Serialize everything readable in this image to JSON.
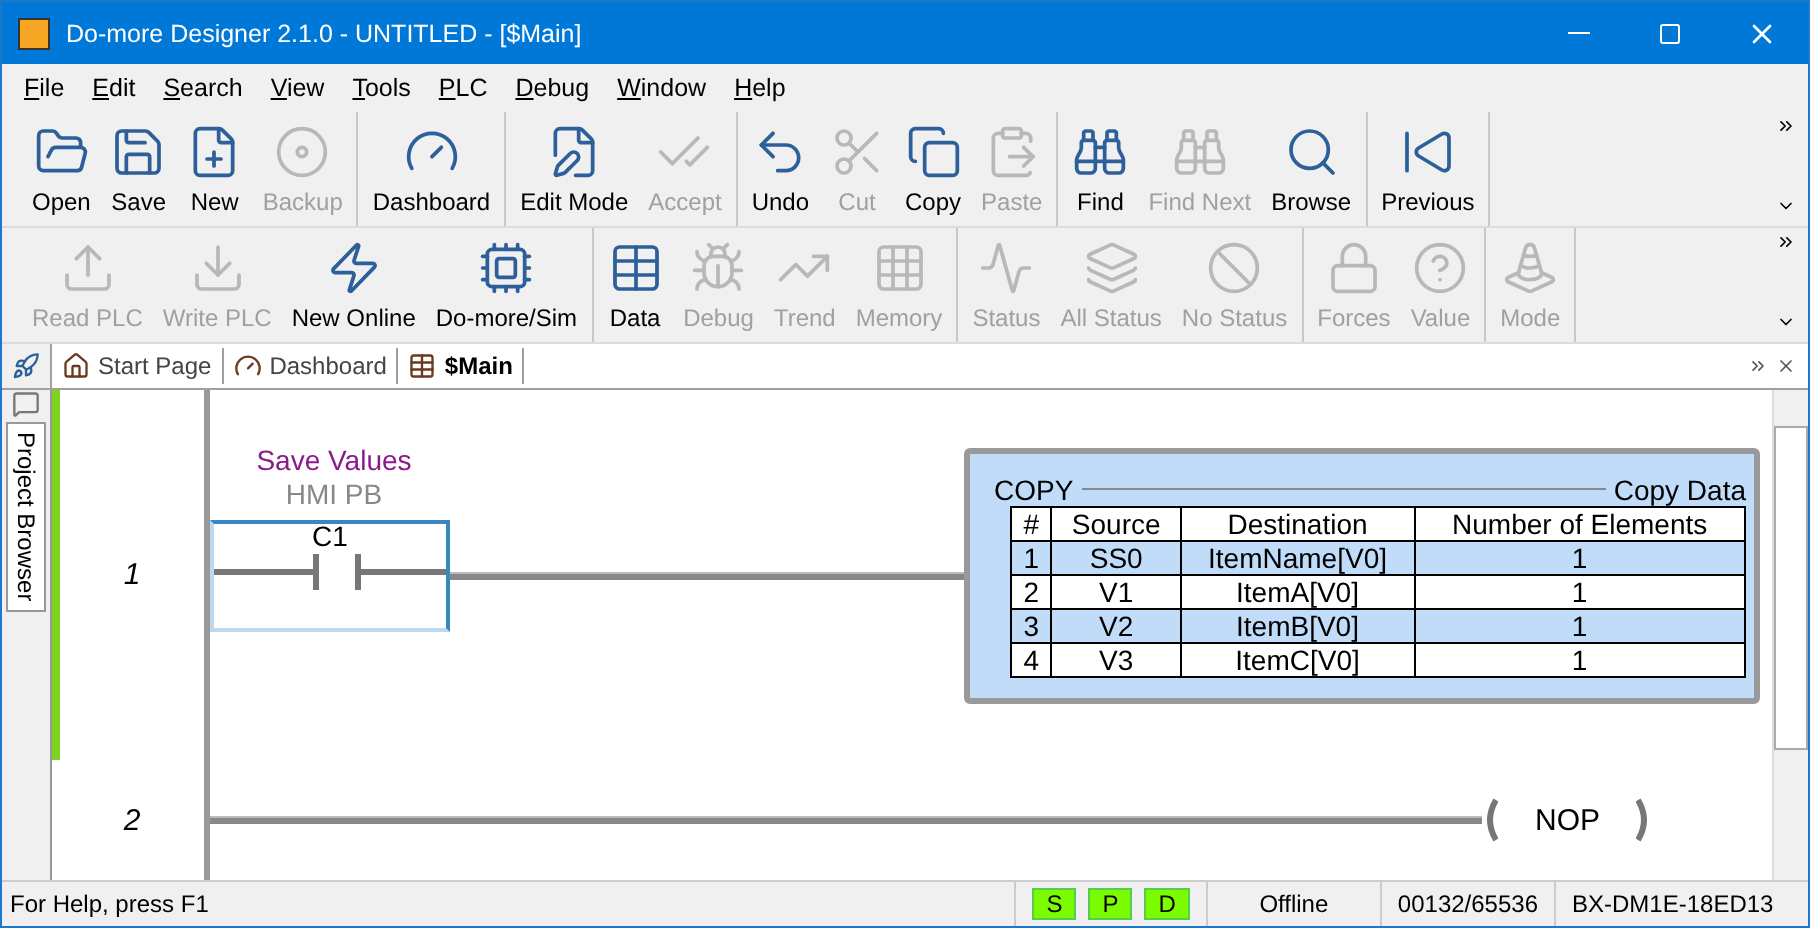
{
  "window": {
    "title": "Do-more Designer 2.1.0 - UNTITLED - [$Main]"
  },
  "menu": [
    "File",
    "Edit",
    "Search",
    "View",
    "Tools",
    "PLC",
    "Debug",
    "Window",
    "Help"
  ],
  "toolbars": [
    {
      "groups": [
        [
          {
            "label": "Open",
            "disabled": false
          },
          {
            "label": "Save",
            "disabled": false
          },
          {
            "label": "New",
            "disabled": false
          },
          {
            "label": "Backup",
            "disabled": true
          }
        ],
        [
          {
            "label": "Dashboard",
            "disabled": false
          }
        ],
        [
          {
            "label": "Edit Mode",
            "disabled": false
          },
          {
            "label": "Accept",
            "disabled": true
          }
        ],
        [
          {
            "label": "Undo",
            "disabled": false
          },
          {
            "label": "Cut",
            "disabled": true
          },
          {
            "label": "Copy",
            "disabled": false
          },
          {
            "label": "Paste",
            "disabled": true
          }
        ],
        [
          {
            "label": "Find",
            "disabled": false
          },
          {
            "label": "Find Next",
            "disabled": true
          },
          {
            "label": "Browse",
            "disabled": false
          }
        ],
        [
          {
            "label": "Previous",
            "disabled": false
          }
        ]
      ]
    },
    {
      "groups": [
        [
          {
            "label": "Read PLC",
            "disabled": true
          },
          {
            "label": "Write PLC",
            "disabled": true
          },
          {
            "label": "New Online",
            "disabled": false
          },
          {
            "label": "Do-more/Sim",
            "disabled": false
          }
        ],
        [
          {
            "label": "Data",
            "disabled": false
          },
          {
            "label": "Debug",
            "disabled": true
          },
          {
            "label": "Trend",
            "disabled": true
          },
          {
            "label": "Memory",
            "disabled": true
          }
        ],
        [
          {
            "label": "Status",
            "disabled": true
          },
          {
            "label": "All Status",
            "disabled": true
          },
          {
            "label": "No Status",
            "disabled": true
          }
        ],
        [
          {
            "label": "Forces",
            "disabled": true
          },
          {
            "label": "Value",
            "disabled": true
          }
        ],
        [
          {
            "label": "Mode",
            "disabled": true
          }
        ]
      ]
    }
  ],
  "tabs": [
    {
      "label": "Start Page",
      "selected": false
    },
    {
      "label": "Dashboard",
      "selected": false
    },
    {
      "label": "$Main",
      "selected": true
    }
  ],
  "sidebar_tab": "Project Browser",
  "rungs": [
    {
      "number": "1",
      "contact": {
        "nickname": "Save Values",
        "description": "HMI PB",
        "address": "C1"
      },
      "instruction": {
        "name": "COPY",
        "description": "Copy Data",
        "columns": [
          "#",
          "Source",
          "Destination",
          "Number of Elements"
        ],
        "rows": [
          [
            "1",
            "SS0",
            "ItemName[V0]",
            "1"
          ],
          [
            "2",
            "V1",
            "ItemA[V0]",
            "1"
          ],
          [
            "3",
            "V2",
            "ItemB[V0]",
            "1"
          ],
          [
            "4",
            "V3",
            "ItemC[V0]",
            "1"
          ]
        ]
      }
    },
    {
      "number": "2",
      "coil": "NOP"
    }
  ],
  "status_bar": {
    "help": "For Help, press F1",
    "indicators": [
      "S",
      "P",
      "D"
    ],
    "mode": "Offline",
    "memory": "00132/65536",
    "model": "BX-DM1E-18ED13"
  }
}
